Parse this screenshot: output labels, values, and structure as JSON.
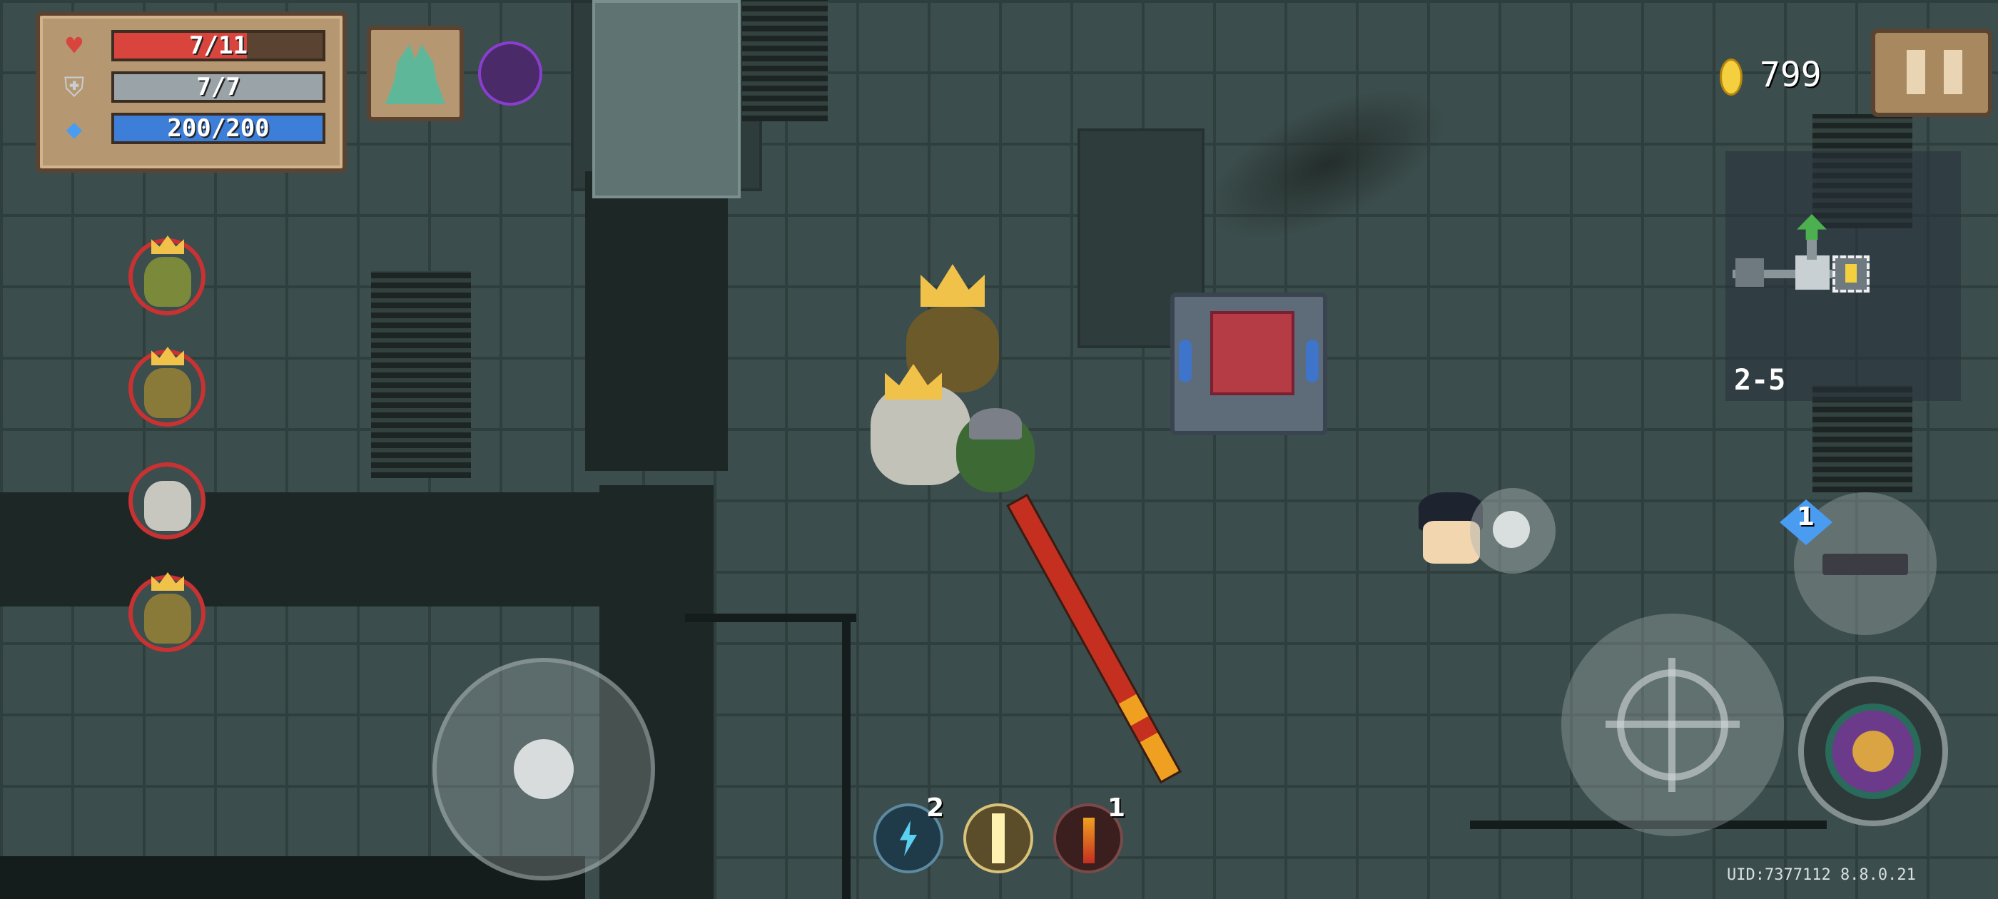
{
  "hud": {
    "health": {
      "text": "7/11",
      "current": 7,
      "max": 11,
      "color": "#d9453d"
    },
    "armor": {
      "text": "7/7",
      "current": 7,
      "max": 7,
      "color": "#9aa3a8"
    },
    "energy": {
      "text": "200/200",
      "current": 200,
      "max": 200,
      "color": "#3d7ed9"
    },
    "buffs": [
      "deer-buff-icon",
      "demon-helmet-buff-icon"
    ]
  },
  "currency": {
    "coins": "799"
  },
  "level": {
    "label": "2-5"
  },
  "weapon": {
    "slot_badge": "1"
  },
  "skills": [
    {
      "icon": "lightning-skill-icon",
      "count": "2"
    },
    {
      "icon": "light-beam-skill-icon",
      "count": ""
    },
    {
      "icon": "fire-sword-skill-icon",
      "count": "1"
    }
  ],
  "followers": [
    "crowned-goblin-pet",
    "crowned-goblin-pet",
    "skull-goblin-pet",
    "crowned-goblin-pet"
  ],
  "footer": {
    "uid": "UID:7377112 8.8.0.21"
  },
  "colors": {
    "panel": "#b59872",
    "frame": "#5a4330",
    "floor": "#3b4d4c"
  }
}
